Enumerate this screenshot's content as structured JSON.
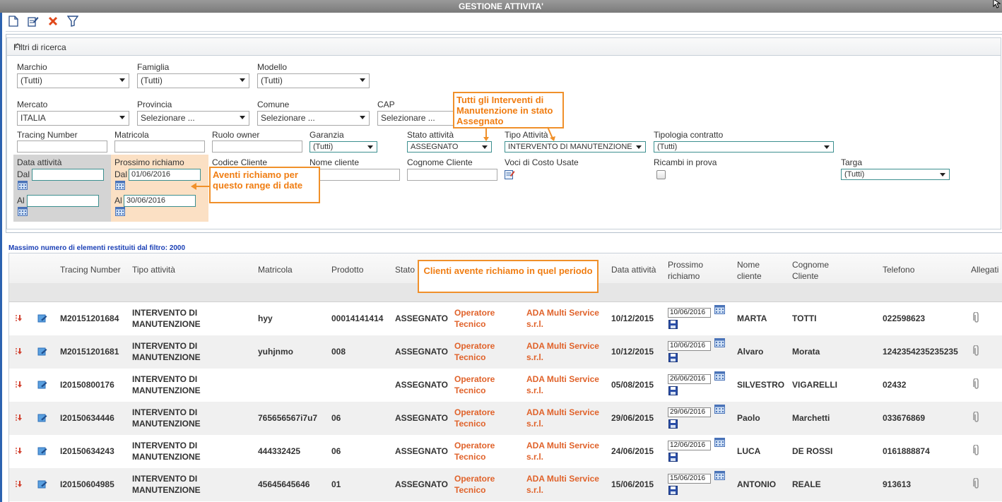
{
  "window": {
    "title": "GESTIONE ATTIVITA'"
  },
  "filters": {
    "title": "Filtri di ricerca",
    "marchio": {
      "label": "Marchio",
      "value": "(Tutti)"
    },
    "famiglia": {
      "label": "Famiglia",
      "value": "(Tutti)"
    },
    "modello": {
      "label": "Modello",
      "value": "(Tutti)"
    },
    "mercato": {
      "label": "Mercato",
      "value": "ITALIA"
    },
    "provincia": {
      "label": "Provincia",
      "value": "Selezionare ..."
    },
    "comune": {
      "label": "Comune",
      "value": "Selezionare ..."
    },
    "cap": {
      "label": "CAP",
      "value": "Selezionare ..."
    },
    "tracing_number": {
      "label": "Tracing Number",
      "value": ""
    },
    "matricola": {
      "label": "Matricola",
      "value": ""
    },
    "ruolo_owner": {
      "label": "Ruolo owner",
      "value": ""
    },
    "garanzia": {
      "label": "Garanzia",
      "value": "(Tutti)"
    },
    "stato_attivita": {
      "label": "Stato attività",
      "value": "ASSEGNATO"
    },
    "tipo_attivita": {
      "label": "Tipo Attività",
      "value": "INTERVENTO DI MANUTENZIONE"
    },
    "tipologia_contratto": {
      "label": "Tipologia contratto",
      "value": "(Tutti)"
    },
    "data_attivita": {
      "label": "Data attività",
      "dal_label": "Dal",
      "al_label": "Al",
      "dal": "",
      "al": ""
    },
    "prossimo_richiamo": {
      "label": "Prossimo richiamo",
      "dal_label": "Dal",
      "al_label": "Al",
      "dal": "01/06/2016",
      "al": "30/06/2016"
    },
    "codice_cliente": {
      "label": "Codice Cliente",
      "value": ""
    },
    "nome_cliente": {
      "label": "Nome cliente",
      "value": ""
    },
    "cognome_cliente": {
      "label": "Cognome Cliente",
      "value": ""
    },
    "voci_costo": {
      "label": "Voci di Costo Usate"
    },
    "ricambi_prova": {
      "label": "Ricambi in prova",
      "checked": false
    },
    "targa": {
      "label": "Targa",
      "value": "(Tutti)"
    }
  },
  "callouts": {
    "stato": "Tutti gli Interventi di Manutenzione in stato Assegnato",
    "richiamo": "Aventi richiamo per questo range di date",
    "clienti": "Clienti avente richiamo in quel periodo"
  },
  "max_note": "Massimo numero di elementi restituiti dal filtro: 2000",
  "columns": {
    "tracing": "Tracing Number",
    "tipo": "Tipo attività",
    "matricola": "Matricola",
    "prodotto": "Prodotto",
    "stato": "Stato",
    "data": "Data attività",
    "prossimo_1": "Prossimo",
    "prossimo_2": "richiamo",
    "nome_1": "Nome",
    "nome_2": "cliente",
    "cognome_1": "Cognome",
    "cognome_2": "Cliente",
    "telefono": "Telefono",
    "allegati": "Allegati"
  },
  "rows": [
    {
      "tracing": "M20151201684",
      "tipo1": "INTERVENTO DI",
      "tipo2": "MANUTENZIONE",
      "matricola": "hyy",
      "prodotto": "00014141414",
      "stato": "ASSEGNATO",
      "ruolo1": "Operatore",
      "ruolo2": "Tecnico",
      "az1": "ADA Multi Service",
      "az2": "s.r.l.",
      "data": "10/12/2015",
      "richiamo": "10/06/2016",
      "nome": "MARTA",
      "cognome": "TOTTI",
      "telefono": "022598623"
    },
    {
      "tracing": "M20151201681",
      "tipo1": "INTERVENTO DI",
      "tipo2": "MANUTENZIONE",
      "matricola": "yuhjnmo",
      "prodotto": "008",
      "stato": "ASSEGNATO",
      "ruolo1": "Operatore",
      "ruolo2": "Tecnico",
      "az1": "ADA Multi Service",
      "az2": "s.r.l.",
      "data": "10/12/2015",
      "richiamo": "10/06/2016",
      "nome": "Alvaro",
      "cognome": "Morata",
      "telefono": "1242354235235235"
    },
    {
      "tracing": "I20150800176",
      "tipo1": "INTERVENTO DI",
      "tipo2": "MANUTENZIONE",
      "matricola": "",
      "prodotto": "",
      "stato": "ASSEGNATO",
      "ruolo1": "Operatore",
      "ruolo2": "Tecnico",
      "az1": "ADA Multi Service",
      "az2": "s.r.l.",
      "data": "05/08/2015",
      "richiamo": "26/06/2016",
      "nome": "SILVESTRO",
      "cognome": "VIGARELLI",
      "telefono": "02432"
    },
    {
      "tracing": "I20150634446",
      "tipo1": "INTERVENTO DI",
      "tipo2": "MANUTENZIONE",
      "matricola": "765656567i7u7",
      "prodotto": "06",
      "stato": "ASSEGNATO",
      "ruolo1": "Operatore",
      "ruolo2": "Tecnico",
      "az1": "ADA Multi Service",
      "az2": "s.r.l.",
      "data": "29/06/2015",
      "richiamo": "29/06/2016",
      "nome": "Paolo",
      "cognome": "Marchetti",
      "telefono": "033676869"
    },
    {
      "tracing": "I20150634243",
      "tipo1": "INTERVENTO DI",
      "tipo2": "MANUTENZIONE",
      "matricola": "444332425",
      "prodotto": "06",
      "stato": "ASSEGNATO",
      "ruolo1": "Operatore",
      "ruolo2": "Tecnico",
      "az1": "ADA Multi Service",
      "az2": "s.r.l.",
      "data": "24/06/2015",
      "richiamo": "12/06/2016",
      "nome": "LUCA",
      "cognome": "DE ROSSI",
      "telefono": "0161888874"
    },
    {
      "tracing": "I20150604985",
      "tipo1": "INTERVENTO DI",
      "tipo2": "MANUTENZIONE",
      "matricola": "45645645646",
      "prodotto": "01",
      "stato": "ASSEGNATO",
      "ruolo1": "Operatore",
      "ruolo2": "Tecnico",
      "az1": "ADA Multi Service",
      "az2": "s.r.l.",
      "data": "15/06/2015",
      "richiamo": "15/06/2016",
      "nome": "ANTONIO",
      "cognome": "REALE",
      "telefono": "913613"
    }
  ]
}
